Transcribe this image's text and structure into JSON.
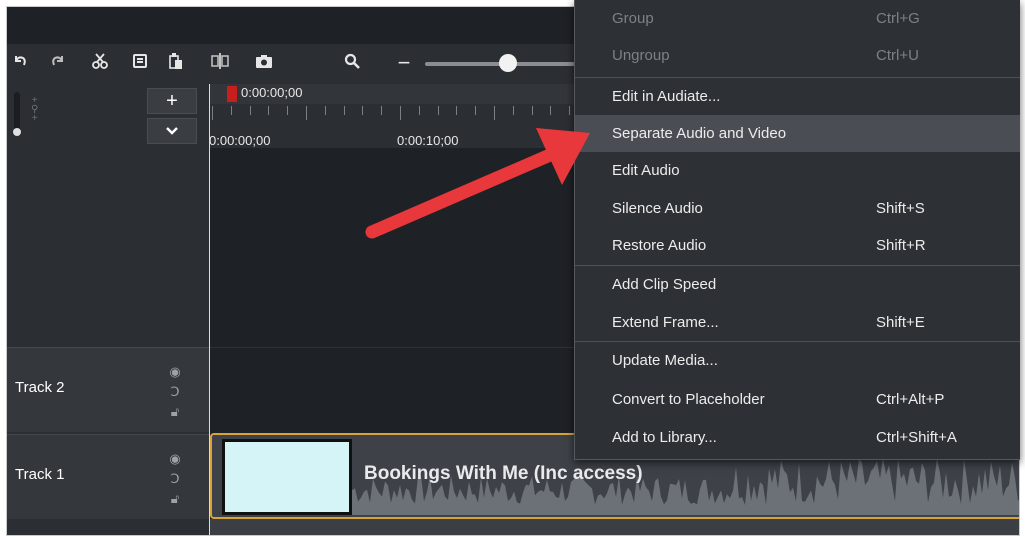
{
  "toolbar": {
    "icons": [
      "undo-icon",
      "redo-icon",
      "cut-icon",
      "copy-icon",
      "paste-icon",
      "split-icon",
      "snapshot-icon",
      "zoom-icon"
    ],
    "zoom_level_fraction": 0.55
  },
  "timeline": {
    "playhead_time": "0:00:00;00",
    "ruler_labels": [
      "0:00:00;00",
      "0:00:10;00"
    ],
    "add_track_label": "+",
    "collapse_label": "⌄"
  },
  "tracks": [
    {
      "name": "Track 2"
    },
    {
      "name": "Track 1"
    }
  ],
  "clip": {
    "title": "Bookings With Me (Inc access)",
    "thumb_color": "#d5f4f7",
    "border_color": "#d8a437"
  },
  "context_menu": {
    "items": [
      {
        "label": "Group",
        "shortcut": "Ctrl+G",
        "disabled": false
      },
      {
        "label": "Ungroup",
        "shortcut": "Ctrl+U",
        "disabled": true
      },
      {
        "label": "Edit in Audiate...",
        "shortcut": "",
        "disabled": false
      },
      {
        "label": "Separate Audio and Video",
        "shortcut": "",
        "disabled": false,
        "highlight": true
      },
      {
        "label": "Edit Audio",
        "shortcut": "",
        "disabled": false
      },
      {
        "label": "Silence Audio",
        "shortcut": "Shift+S",
        "disabled": false
      },
      {
        "label": "Restore Audio",
        "shortcut": "Shift+R",
        "disabled": false
      },
      {
        "label": "Add Clip Speed",
        "shortcut": "",
        "disabled": false
      },
      {
        "label": "Extend Frame...",
        "shortcut": "Shift+E",
        "disabled": false
      },
      {
        "label": "Update Media...",
        "shortcut": "",
        "disabled": false
      },
      {
        "label": "Convert to Placeholder",
        "shortcut": "Ctrl+Alt+P",
        "disabled": false
      },
      {
        "label": "Add to Library...",
        "shortcut": "Ctrl+Shift+A",
        "disabled": false
      }
    ]
  },
  "annotation": {
    "arrow_color": "#e8383b"
  }
}
